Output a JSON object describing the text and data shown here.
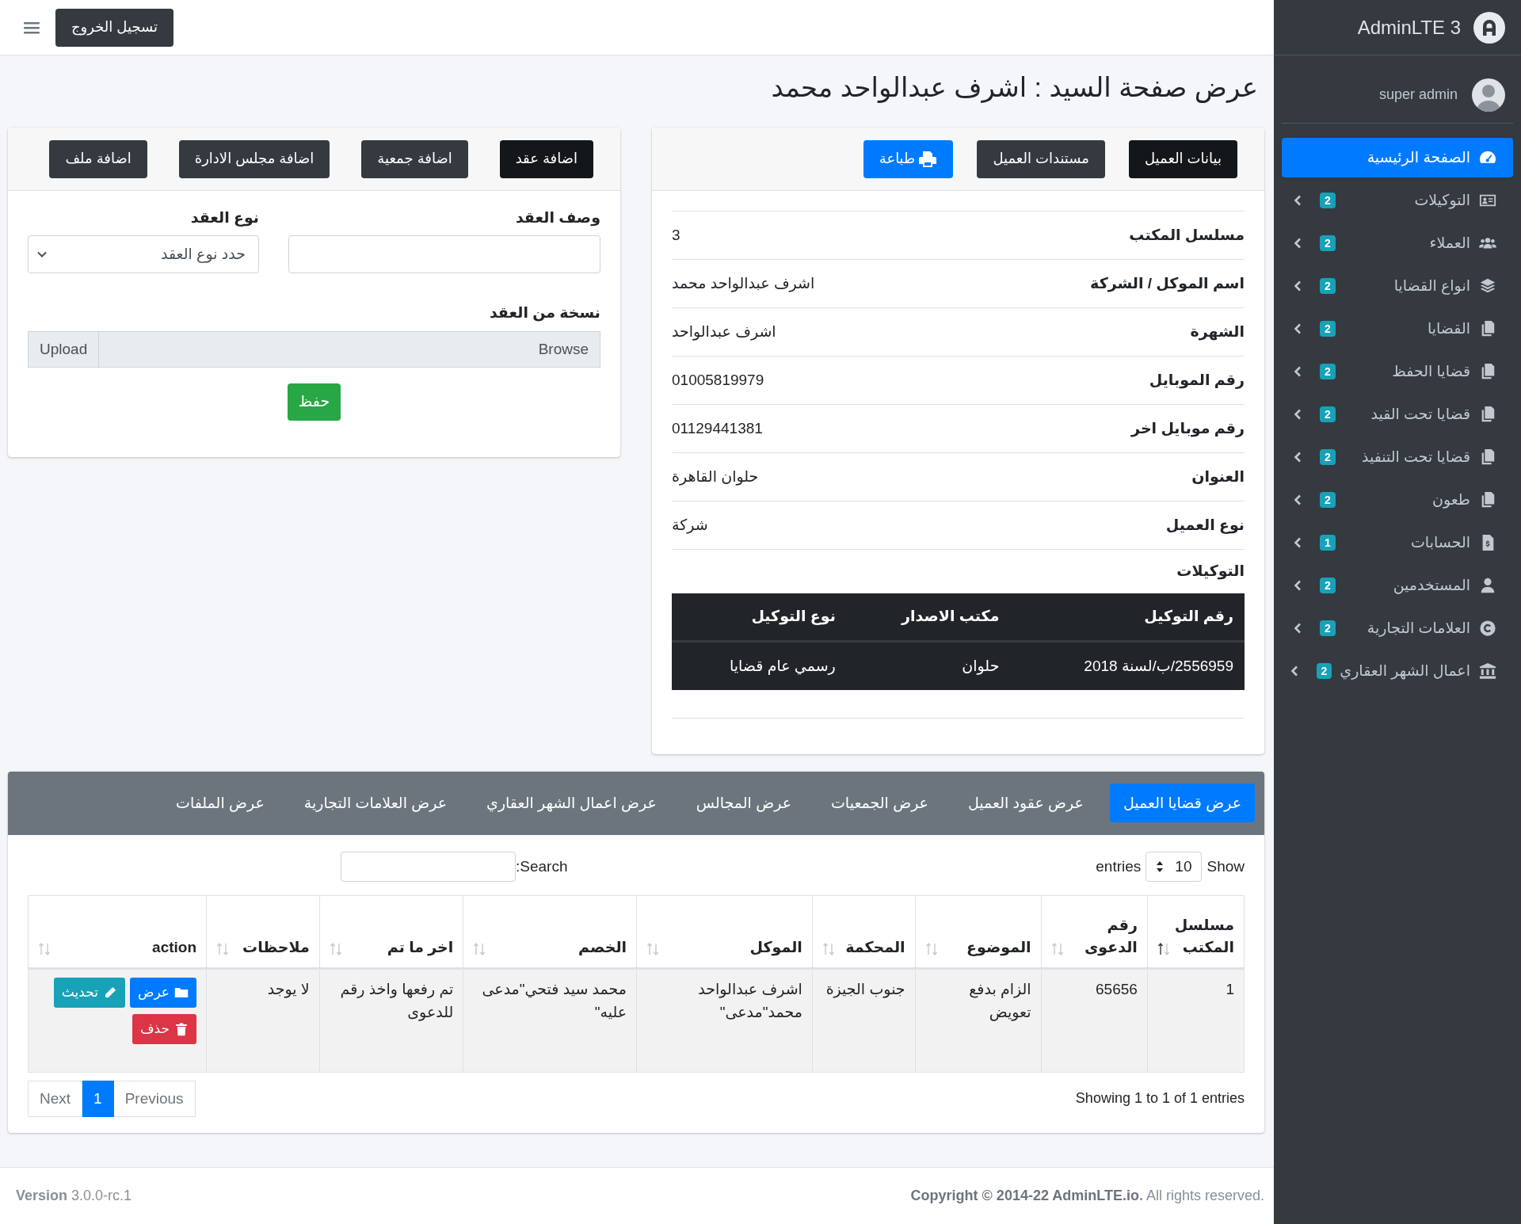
{
  "navbar": {
    "logout": "تسجيل الخروج"
  },
  "sidebar": {
    "brand": "AdminLTE 3",
    "user": "super admin",
    "items": [
      {
        "label": "الصفحة الرئيسية",
        "selected": true
      },
      {
        "label": "التوكيلات",
        "badge": "2",
        "selected": false
      },
      {
        "label": "العملاء",
        "badge": "2",
        "selected": false
      },
      {
        "label": "انواع القضايا",
        "badge": "2",
        "selected": false
      },
      {
        "label": "القضايا",
        "badge": "2",
        "selected": false
      },
      {
        "label": "قضايا الحفظ",
        "badge": "2",
        "selected": false
      },
      {
        "label": "قضايا تحت القيد",
        "badge": "2",
        "selected": false
      },
      {
        "label": "قضايا تحت التنفيذ",
        "badge": "2",
        "selected": false
      },
      {
        "label": "طعون",
        "badge": "2",
        "selected": false
      },
      {
        "label": "الحسابات",
        "badge": "1",
        "selected": false
      },
      {
        "label": "المستخدمين",
        "badge": "2",
        "selected": false
      },
      {
        "label": "العلامات التجارية",
        "badge": "2",
        "selected": false
      },
      {
        "label": "اعمال الشهر العقاري",
        "badge": "2",
        "selected": false
      }
    ]
  },
  "page_title": "عرض صفحة السيد : اشرف عبدالواحد محمد",
  "client_card": {
    "buttons": [
      {
        "label": "بيانات العميل",
        "kind": "tab",
        "selected": true
      },
      {
        "label": "مستندات العميل",
        "kind": "tab",
        "selected": false
      },
      {
        "label": "طباعة",
        "kind": "print"
      }
    ],
    "fields": [
      {
        "label": "مسلسل المكتب",
        "value": "3"
      },
      {
        "label": "اسم الموكل / الشركة",
        "value": "اشرف عبدالواحد محمد"
      },
      {
        "label": "الشهرة",
        "value": "اشرف عبدالواحد"
      },
      {
        "label": "رقم الموبايل",
        "value": "01005819979"
      },
      {
        "label": "رقم موبايل اخر",
        "value": "01129441381"
      },
      {
        "label": "العنوان",
        "value": "حلوان القاهرة"
      },
      {
        "label": "نوع العميل",
        "value": "شركة"
      }
    ],
    "section_title": "التوكيلات",
    "table": {
      "columns": [
        "رقم التوكيل",
        "مكتب الاصدار",
        "نوع التوكيل"
      ],
      "rows": [
        [
          "2556959/ب/لسنة 2018",
          "حلوان",
          "رسمي عام قضايا"
        ]
      ]
    }
  },
  "contract_card": {
    "buttons": [
      {
        "label": "اضافة عقد",
        "selected": true
      },
      {
        "label": "اضافة جمعية",
        "selected": false
      },
      {
        "label": "اضافة مجلس الادارة",
        "selected": false
      },
      {
        "label": "اضافة ملف",
        "selected": false
      }
    ],
    "form": {
      "description_label": "وصف العقد",
      "type_label": "نوع العقد",
      "type_value": "حدد نوع العقد",
      "file_label": "نسخة من العقد",
      "browse": "Browse",
      "upload": "Upload",
      "save": "حفظ"
    }
  },
  "cases_card": {
    "tabs": [
      {
        "label": "عرض قضايا العميل",
        "selected": true
      },
      {
        "label": "عرض عقود العميل",
        "selected": false
      },
      {
        "label": "عرض الجمعيات",
        "selected": false
      },
      {
        "label": "عرض المجالس",
        "selected": false
      },
      {
        "label": "عرض اعمال الشهر العقاري",
        "selected": false
      },
      {
        "label": "عرض العلامات التجارية",
        "selected": false
      },
      {
        "label": "عرض الملفات",
        "selected": false
      }
    ],
    "length": {
      "show": "Show",
      "value": "10",
      "entries": "entries"
    },
    "search_label": "Search:",
    "columns": [
      {
        "label": "مسلسل المكتب",
        "sorted": true
      },
      {
        "label": "رقم الدعوى",
        "sorted": false
      },
      {
        "label": "الموضوع",
        "sorted": false
      },
      {
        "label": "المحكمة",
        "sorted": false
      },
      {
        "label": "الموكل",
        "sorted": false
      },
      {
        "label": "الخصم",
        "sorted": false
      },
      {
        "label": "اخر ما تم",
        "sorted": false
      },
      {
        "label": "ملاحظات",
        "sorted": false
      },
      {
        "label": "action",
        "sorted": false
      }
    ],
    "rows": [
      {
        "cells": [
          "1",
          "65656",
          "الزام بدفع تعويض",
          "جنوب الجيزة",
          "اشرف عبدالواحد محمد\"مدعى\"",
          "محمد سيد فتحي\"مدعى عليه\"",
          "تم رفعها واخذ رقم للدعوى",
          "لا يوجد"
        ],
        "actions": [
          {
            "label": "عرض",
            "kind": "view"
          },
          {
            "label": "تحديث",
            "kind": "edit"
          },
          {
            "label": "حذف",
            "kind": "delete"
          }
        ]
      }
    ],
    "info": "Showing 1 to 1 of 1 entries",
    "pagination": [
      {
        "label": "Previous",
        "selected": false
      },
      {
        "label": "1",
        "selected": true
      },
      {
        "label": "Next",
        "selected": false
      }
    ]
  },
  "footer": {
    "copyright_before": "Copyright © 2014-22 ",
    "copyright_link": "AdminLTE.io",
    "copyright_after": "**.** All rights reserved.",
    "version": "**Version** 3.0.0-rc.1"
  }
}
